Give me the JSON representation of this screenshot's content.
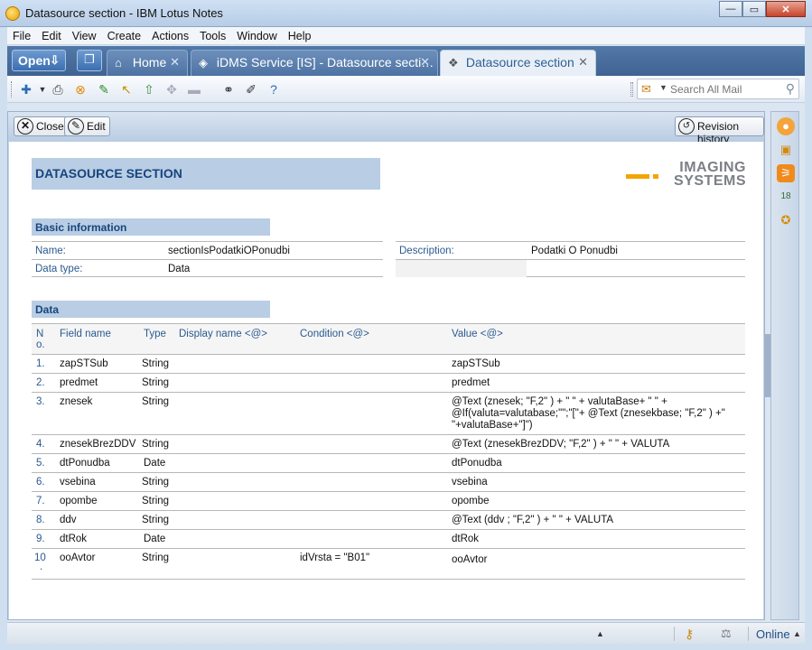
{
  "window": {
    "title": "Datasource section - IBM Lotus Notes"
  },
  "menu": [
    "File",
    "Edit",
    "View",
    "Create",
    "Actions",
    "Tools",
    "Window",
    "Help"
  ],
  "tabbar": {
    "open_label": "Open",
    "tabs": [
      {
        "label": "Home",
        "icon": "home-icon"
      },
      {
        "label": "iDMS Service [IS] - Datasource secti…",
        "icon": "database-icon"
      },
      {
        "label": "Datasource section",
        "icon": "document-icon"
      }
    ]
  },
  "search": {
    "placeholder": "Search All Mail"
  },
  "actions": {
    "close_label": "Close",
    "edit_label": "Edit",
    "revision_label": "Revision history"
  },
  "document": {
    "title": "DATASOURCE SECTION",
    "logo_line1": "IMAGING",
    "logo_line2": "SYSTEMS",
    "basic_heading": "Basic information",
    "name_label": "Name:",
    "name_value": "sectionIsPodatkiOPonudbi",
    "description_label": "Description:",
    "description_value": "Podatki O Ponudbi",
    "datatype_label": "Data type:",
    "datatype_value": "Data",
    "data_heading": "Data",
    "columns": {
      "no_line1": "N",
      "no_line2": "o.",
      "field": "Field name",
      "type": "Type",
      "display": "Display name <@>",
      "condition": "Condition <@>",
      "value": "Value <@>"
    },
    "rows": [
      {
        "no": "1.",
        "field": "zapSTSub",
        "type": "String",
        "condition": "",
        "value": [
          "zapSTSub"
        ]
      },
      {
        "no": "2.",
        "field": "predmet",
        "type": "String",
        "condition": "",
        "value": [
          "predmet"
        ]
      },
      {
        "no": "3.",
        "field": "znesek",
        "type": "String",
        "condition": "",
        "value": [
          "@Text (znesek; \"F,2\" ) + \" \" + valutaBase+ \" \" +",
          "@If(valuta=valutabase;\"\";\"[\"+ @Text (znesekbase; \"F,2\" )  +\"",
          "\"+valutaBase+\"]\")"
        ]
      },
      {
        "no": "4.",
        "field": "znesekBrezDDV",
        "type": "String",
        "condition": "",
        "value": [
          "@Text (znesekBrezDDV; \"F,2\" ) + \" \" + VALUTA"
        ]
      },
      {
        "no": "5.",
        "field": "dtPonudba",
        "type": "Date",
        "condition": "",
        "value": [
          "dtPonudba"
        ]
      },
      {
        "no": "6.",
        "field": "vsebina",
        "type": "String",
        "condition": "",
        "value": [
          "vsebina"
        ]
      },
      {
        "no": "7.",
        "field": "opombe",
        "type": "String",
        "condition": "",
        "value": [
          "opombe"
        ]
      },
      {
        "no": "8.",
        "field": "ddv",
        "type": "String",
        "condition": "",
        "value": [
          "@Text (ddv ; \"F,2\" ) + \" \" +  VALUTA"
        ]
      },
      {
        "no": "9.",
        "field": "dtRok",
        "type": "Date",
        "condition": "",
        "value": [
          "dtRok"
        ]
      },
      {
        "no": "10",
        "no2": ".",
        "field": "ooAvtor",
        "type": "String",
        "condition": "idVrsta = \"B01\"",
        "value": [
          "ooAvtor"
        ]
      }
    ]
  },
  "status": {
    "online_label": "Online"
  },
  "colors": {
    "accent": "#17457d",
    "header_fill": "#b9cde4",
    "tabbar": "#3f6392"
  }
}
